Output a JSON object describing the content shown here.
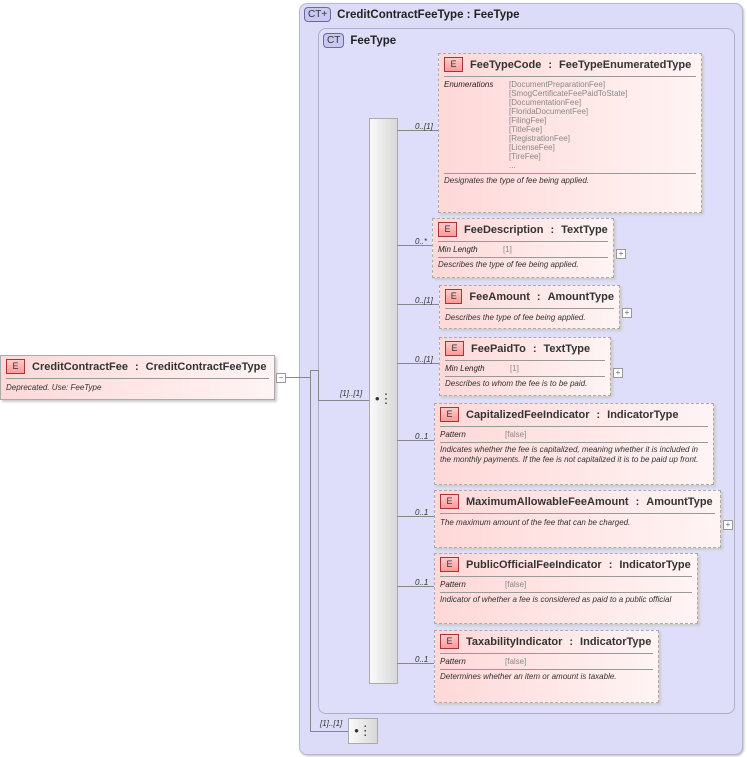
{
  "root": {
    "name": "CreditContractFee",
    "type": "CreditContractFeeType",
    "doc": "Deprecated. Use: FeeType",
    "badge": "E",
    "collapse": "−"
  },
  "outer": {
    "badge": "CT+",
    "title": "CreditContractFeeType : FeeType",
    "cardinality": "[1]..[1]"
  },
  "inner": {
    "badge": "CT",
    "title": "FeeType"
  },
  "sequence": {
    "cardinality": "[1]..[1]"
  },
  "elements": [
    {
      "name": "FeeTypeCode",
      "type": "FeeTypeEnumeratedType",
      "card": "0..[1]",
      "facet": "Enumerations",
      "values": [
        "[DocumentPreparationFee]",
        "[SmogCertificateFeePaidToState]",
        "[DocumentationFee]",
        "[FloridaDocumentFee]",
        "[FilingFee]",
        "[TitleFee]",
        "[RegistrationFee]",
        "[LicenseFee]",
        "[TireFee]",
        "..."
      ],
      "doc": "Designates the type of fee being applied.",
      "expand": false
    },
    {
      "name": "FeeDescription",
      "type": "TextType",
      "card": "0..*",
      "facet": "Min Length",
      "values": [
        "[1]"
      ],
      "doc": "Describes the type of fee being applied.",
      "expand": true
    },
    {
      "name": "FeeAmount",
      "type": "AmountType",
      "card": "0..[1]",
      "doc": "Describes the type of fee being applied.",
      "expand": true
    },
    {
      "name": "FeePaidTo",
      "type": "TextType",
      "card": "0..[1]",
      "facet": "Min Length",
      "values": [
        "[1]"
      ],
      "doc": "Describes to whom the fee is to be paid.",
      "expand": true
    },
    {
      "name": "CapitalizedFeeIndicator",
      "type": "IndicatorType",
      "card": "0..1",
      "facet": "Pattern",
      "values": [
        "[false]"
      ],
      "doc": "Indicates whether the fee is capitalized, meaning whether it is included in the monthly payments. If the fee is not capitalized it is to be paid up front.",
      "expand": false
    },
    {
      "name": "MaximumAllowableFeeAmount",
      "type": "AmountType",
      "card": "0..1",
      "doc": "The maximum amount of the fee that can be charged.",
      "expand": true
    },
    {
      "name": "PublicOfficialFeeIndicator",
      "type": "IndicatorType",
      "card": "0..1",
      "facet": "Pattern",
      "values": [
        "[false]"
      ],
      "doc": "Indicator of whether a fee is considered as paid to a public official",
      "expand": false
    },
    {
      "name": "TaxabilityIndicator",
      "type": "IndicatorType",
      "card": "0..1",
      "facet": "Pattern",
      "values": [
        "[false]"
      ],
      "doc": "Determines whether an item or amount is taxable.",
      "expand": false
    }
  ]
}
